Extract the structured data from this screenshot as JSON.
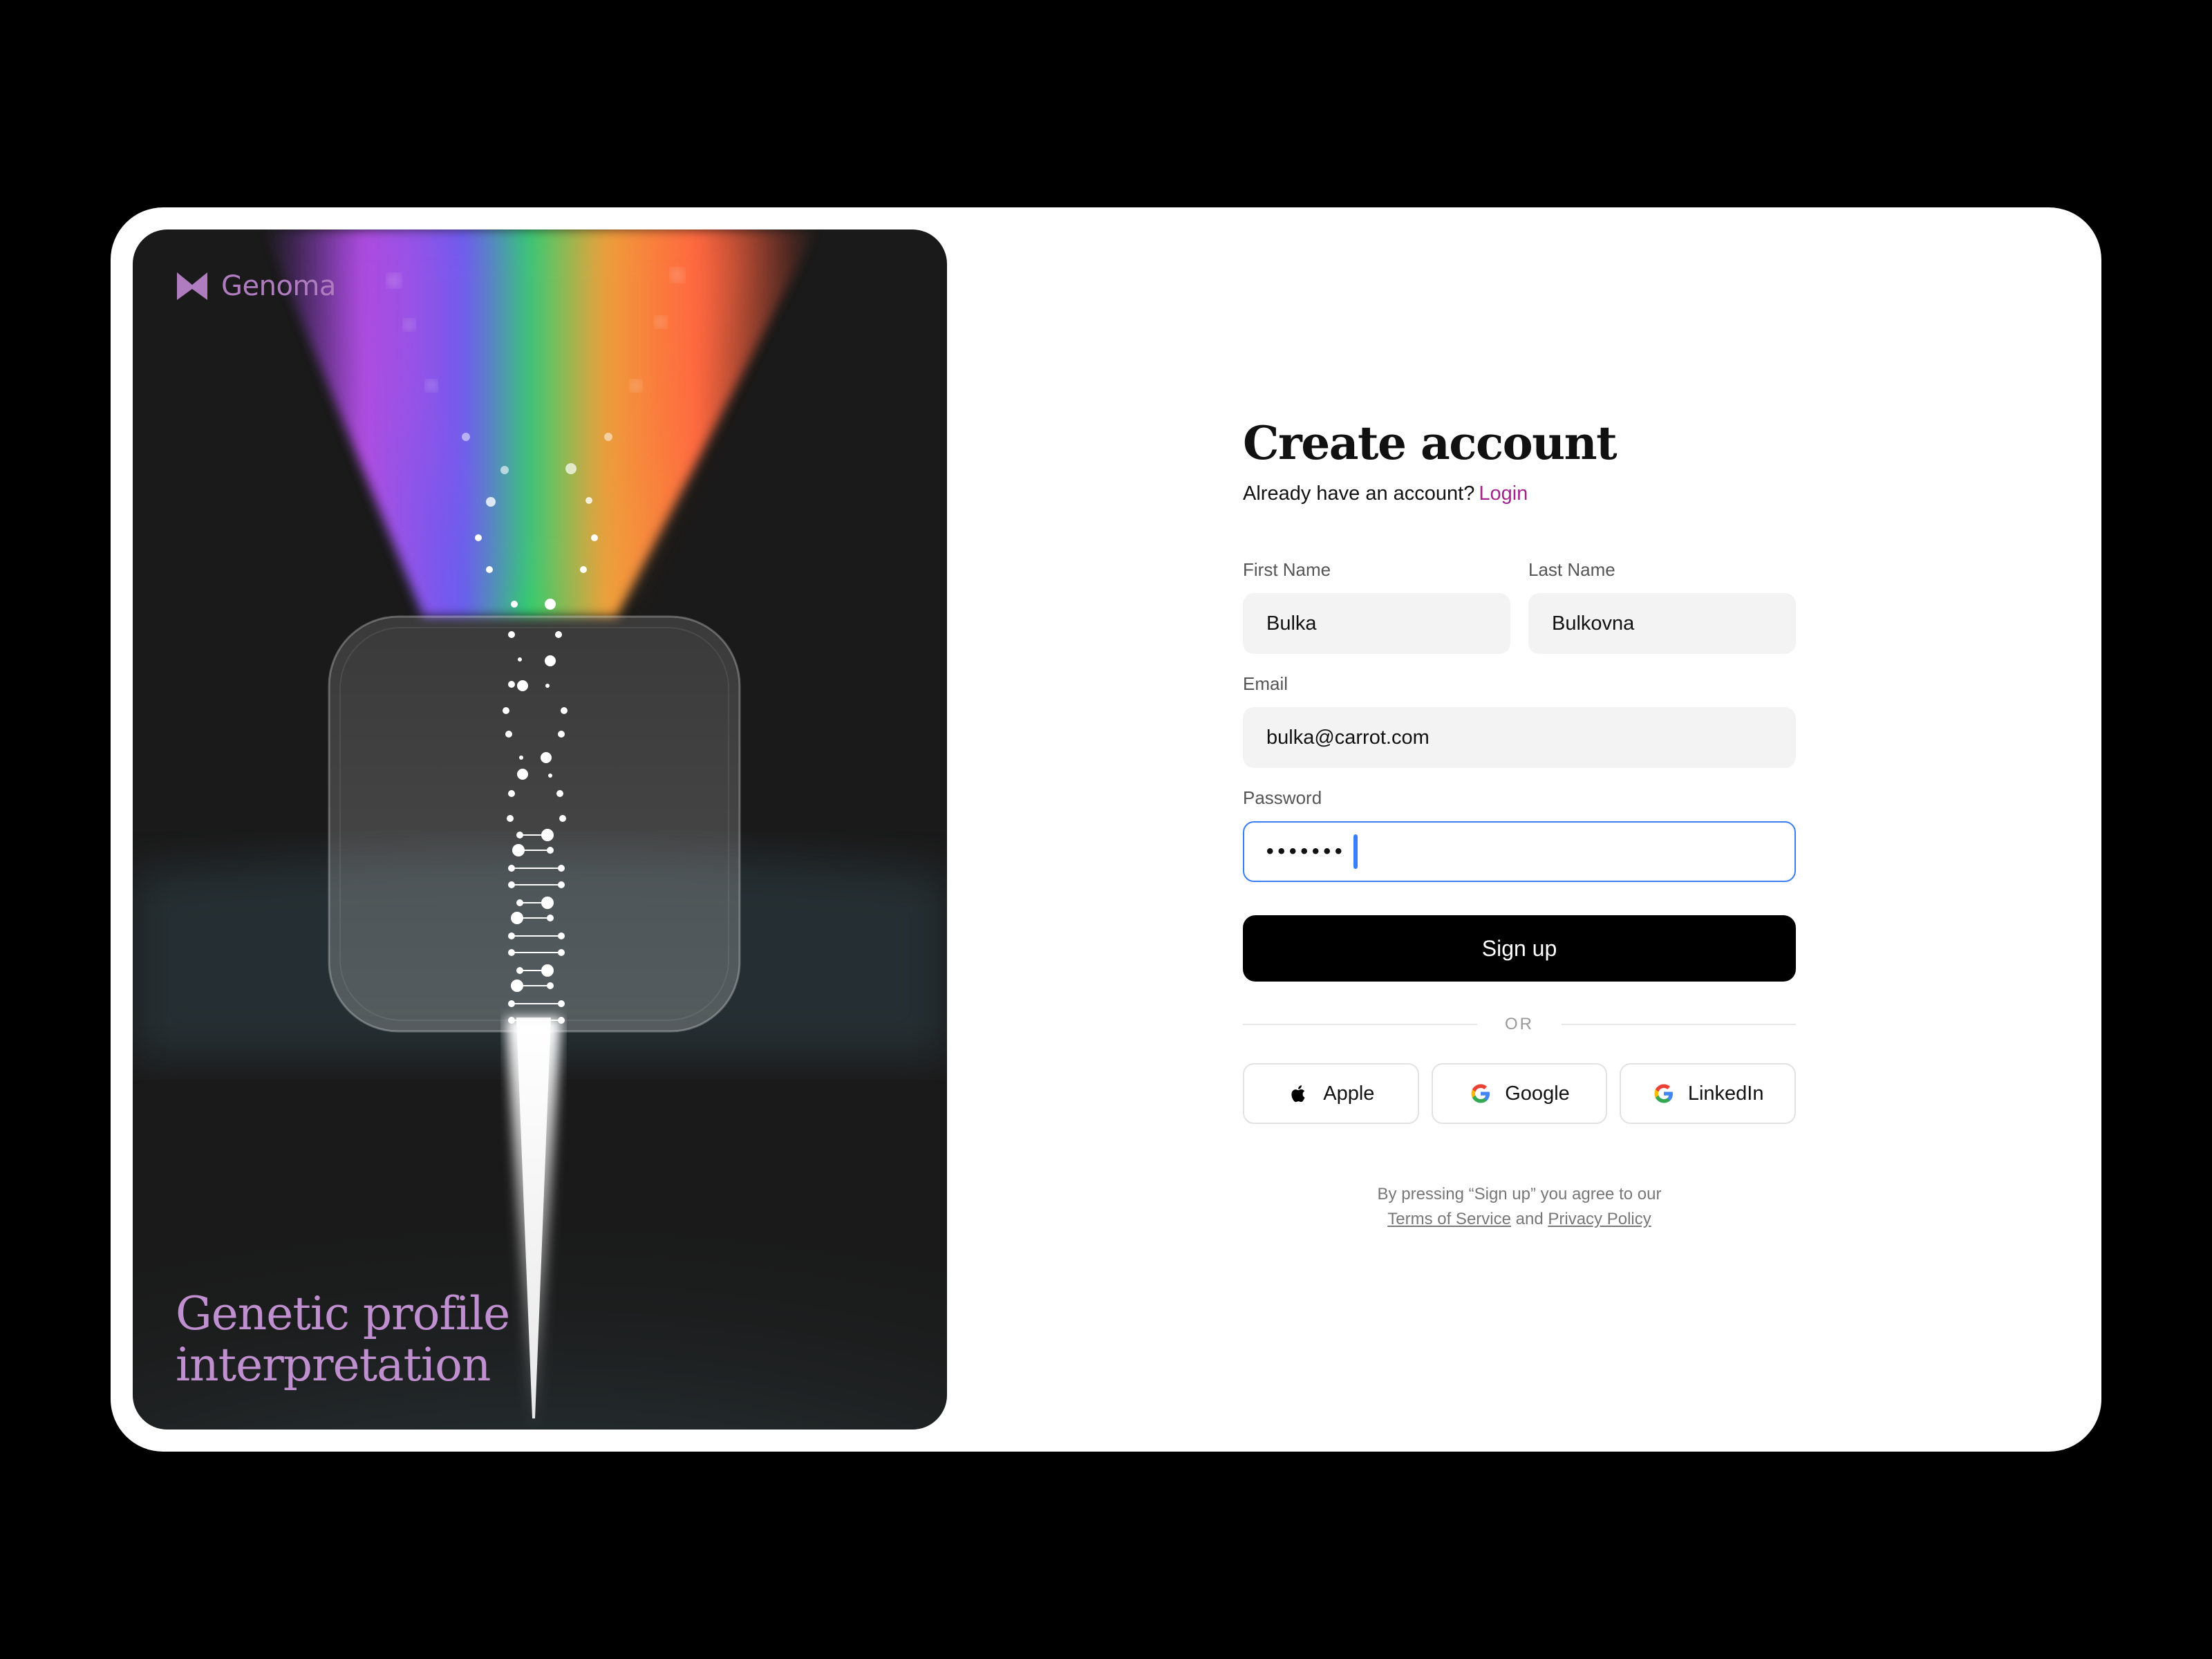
{
  "brand": {
    "name": "Genoma"
  },
  "art": {
    "tagline_line1": "Genetic profile",
    "tagline_line2": "interpretation"
  },
  "form": {
    "title": "Create account",
    "login_prompt": "Already have an account?",
    "login_link": "Login",
    "first_name": {
      "label": "First Name",
      "value": "Bulka"
    },
    "last_name": {
      "label": "Last Name",
      "value": "Bulkovna"
    },
    "email": {
      "label": "Email",
      "value": "bulka@carrot.com"
    },
    "password": {
      "label": "Password",
      "masked_value": "•••••••",
      "focused": true
    },
    "submit_label": "Sign up",
    "divider_text": "OR",
    "social": [
      {
        "label": "Apple",
        "icon": "apple-icon"
      },
      {
        "label": "Google",
        "icon": "google-icon"
      },
      {
        "label": "LinkedIn",
        "icon": "google-icon"
      }
    ],
    "legal_line1": "By pressing “Sign up” you agree to our",
    "terms_link": "Terms of Service",
    "legal_and": "and",
    "privacy_link": "Privacy Policy"
  },
  "colors": {
    "accent_link": "#a4228f",
    "brand_purple": "#b07cc0",
    "focus_blue": "#3b7df6",
    "button_black": "#000000"
  }
}
